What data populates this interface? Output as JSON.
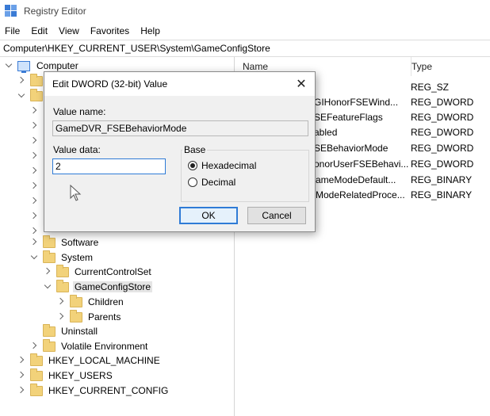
{
  "window": {
    "title": "Registry Editor"
  },
  "menu": [
    "File",
    "Edit",
    "View",
    "Favorites",
    "Help"
  ],
  "address": "Computer\\HKEY_CURRENT_USER\\System\\GameConfigStore",
  "tree": {
    "root": "Computer",
    "items": {
      "software": "Software",
      "system": "System",
      "current_control_set": "CurrentControlSet",
      "game_config_store": "GameConfigStore",
      "children": "Children",
      "parents": "Parents",
      "uninstall": "Uninstall",
      "volatile_environment": "Volatile Environment",
      "hklm": "HKEY_LOCAL_MACHINE",
      "hku": "HKEY_USERS",
      "hkcc": "HKEY_CURRENT_CONFIG"
    }
  },
  "list": {
    "headers": {
      "name": "Name",
      "type": "Type"
    },
    "rows": [
      {
        "name": "",
        "type": "REG_SZ"
      },
      {
        "name": "GIHonorFSEWind...",
        "type": "REG_DWORD"
      },
      {
        "name": "SEFeatureFlags",
        "type": "REG_DWORD"
      },
      {
        "name": "abled",
        "type": "REG_DWORD"
      },
      {
        "name": "SEBehaviorMode",
        "type": "REG_DWORD"
      },
      {
        "name": "onorUserFSEBehavi...",
        "type": "REG_DWORD"
      },
      {
        "name": "ameModeDefault...",
        "type": "REG_BINARY"
      },
      {
        "name": "ModeRelatedProce...",
        "type": "REG_BINARY"
      }
    ]
  },
  "dialog": {
    "title": "Edit DWORD (32-bit) Value",
    "close": "✕",
    "value_name_label": "Value name:",
    "value_name": "GameDVR_FSEBehaviorMode",
    "value_data_label": "Value data:",
    "value_data": "2",
    "base_label": "Base",
    "hex_label": "Hexadecimal",
    "dec_label": "Decimal",
    "base_selected": "Hexadecimal",
    "ok": "OK",
    "cancel": "Cancel"
  }
}
